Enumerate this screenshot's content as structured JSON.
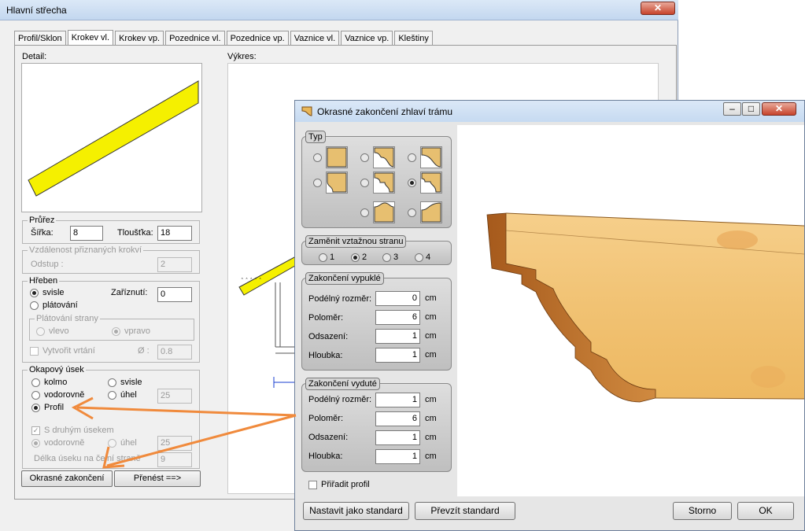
{
  "main_window": {
    "title": "Hlavní střecha",
    "close": "✕",
    "tabs": [
      "Profil/Sklon",
      "Krokev vl.",
      "Krokev vp.",
      "Pozednice vl.",
      "Pozednice vp.",
      "Vaznice vl.",
      "Vaznice vp.",
      "Kleštiny"
    ],
    "detail_label": "Detail:",
    "drawing_label": "Výkres:",
    "prurez": {
      "title": "Průřez",
      "sirka_label": "Šířka:",
      "sirka_value": "8",
      "tloustka_label": "Tloušťka:",
      "tloustka_value": "18"
    },
    "vzdalenost": {
      "title": "Vzdálenost přiznaných krokví",
      "odstup_label": "Odstup :",
      "odstup_value": "2"
    },
    "hreben": {
      "title": "Hřeben",
      "svisle": "svisle",
      "platovani": "plátování",
      "zariznuti_label": "Zaříznutí:",
      "zariznuti_value": "0",
      "platovani_strany": "Plátování strany",
      "vlevo": "vlevo",
      "vpravo": "vpravo",
      "vytvorit_vrtani": "Vytvořit vrtání",
      "prumer_label": "Ø :",
      "prumer_value": "0.8"
    },
    "okapovy": {
      "title": "Okapový úsek",
      "kolmo": "kolmo",
      "svisle": "svisle",
      "vodorovne": "vodorovně",
      "uhel": "úhel",
      "uhel_value": "25",
      "profil": "Profil",
      "s_druhym": "S druhým úsekem",
      "vodorovne2": "vodorovně",
      "uhel2": "úhel",
      "uhel2_value": "25",
      "delka_label": "Délka úseku na čelní straně",
      "delka_value": "9"
    },
    "btn_okrasne": "Okrasné zakončení",
    "btn_prenest": "Přenést ==>"
  },
  "dialog": {
    "title": "Okrasné zakončení zhlaví trámu",
    "typ_title": "Typ",
    "zamenit": {
      "title": "Zaměnit vztažnou stranu",
      "options": [
        "1",
        "2",
        "3",
        "4"
      ],
      "selected": "2"
    },
    "vypukle": {
      "title": "Zakončení vypuklé",
      "rows": [
        {
          "label": "Podélný rozměr:",
          "value": "0",
          "unit": "cm"
        },
        {
          "label": "Poloměr:",
          "value": "6",
          "unit": "cm"
        },
        {
          "label": "Odsazení:",
          "value": "1",
          "unit": "cm"
        },
        {
          "label": "Hloubka:",
          "value": "1",
          "unit": "cm"
        }
      ]
    },
    "vydute": {
      "title": "Zakončení vyduté",
      "rows": [
        {
          "label": "Podélný rozměr:",
          "value": "1",
          "unit": "cm"
        },
        {
          "label": "Poloměr:",
          "value": "6",
          "unit": "cm"
        },
        {
          "label": "Odsazení:",
          "value": "1",
          "unit": "cm"
        },
        {
          "label": "Hloubka:",
          "value": "1",
          "unit": "cm"
        }
      ]
    },
    "priradit": "Přiřadit profil",
    "btn_standard": "Nastavit jako standard",
    "btn_prevzit": "Převzít standard",
    "btn_storno": "Storno",
    "btn_ok": "OK",
    "ctrl_min": "–",
    "ctrl_max": "□",
    "ctrl_close": "✕"
  },
  "colors": {
    "beam_yellow": "#f5f000",
    "wood": "#f4c67a",
    "annotation_arrow": "#f08a3c"
  }
}
